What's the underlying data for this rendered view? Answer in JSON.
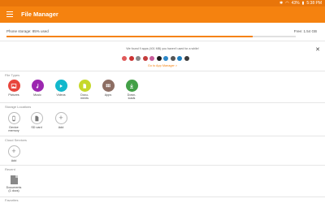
{
  "status_bar": {
    "battery": "43%",
    "time": "5:38 PM"
  },
  "app_bar": {
    "title": "File Manager"
  },
  "storage": {
    "label": "Phone storage: 85% used",
    "free": "Free: 1.54 GB",
    "used_fraction": 0.85
  },
  "promo": {
    "text": "We found 9 apps (401 MB) you haven't used for a while!",
    "link": "Go to App Manager >",
    "app_icon_colors": [
      "#e05a5a",
      "#cc3333",
      "#8a8a8a",
      "#c43c3c",
      "#c85b9a",
      "#1b1b1b",
      "#2d88c9",
      "#555555",
      "#1e7fc1",
      "#3b3b3b"
    ]
  },
  "sections": {
    "file_types": "File Types",
    "storage_locations": "Storage Locations",
    "cloud_services": "Cloud Services",
    "recent": "Recent",
    "favorites": "Favorites"
  },
  "file_types": [
    {
      "label": "Pictures",
      "color": "#e8453c",
      "icon": "image-icon"
    },
    {
      "label": "Music",
      "color": "#9c27b0",
      "icon": "music-icon"
    },
    {
      "label": "Videos",
      "color": "#12b8cc",
      "icon": "video-icon"
    },
    {
      "label": "Docu-\nments",
      "color": "#c6d82b",
      "icon": "document-icon"
    },
    {
      "label": "Apps",
      "color": "#8d6e63",
      "icon": "apps-icon"
    },
    {
      "label": "Down-\nloads",
      "color": "#43a047",
      "icon": "download-icon"
    }
  ],
  "storage_locations": [
    {
      "label": "Device\nmemory",
      "icon": "phone-icon"
    },
    {
      "label": "SD card",
      "icon": "sdcard-icon"
    },
    {
      "label": "Add",
      "icon": "plus-icon"
    }
  ],
  "cloud": [
    {
      "label": "Add",
      "icon": "plus-icon"
    }
  ],
  "recent": [
    {
      "label": "Documents\n(1 docs)",
      "icon": "document-icon"
    }
  ]
}
